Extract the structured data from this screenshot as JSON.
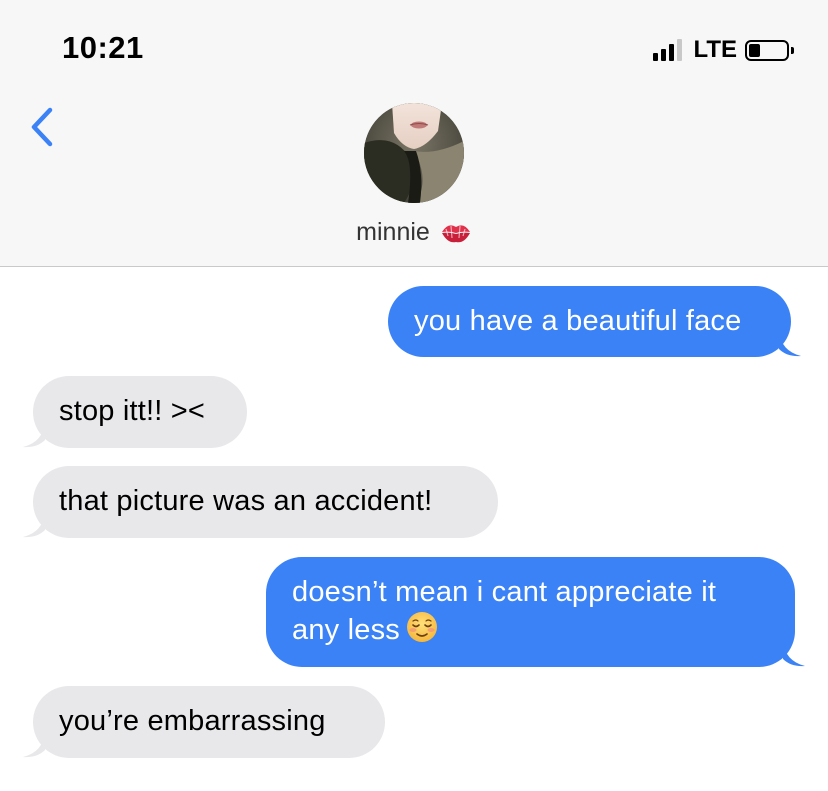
{
  "status_bar": {
    "time": "10:21",
    "network": "LTE",
    "battery_level": 0.25,
    "signal_bars": 3
  },
  "header": {
    "contact_name": "minnie",
    "contact_emoji": "kiss-mark-icon"
  },
  "messages": [
    {
      "direction": "sent",
      "text": "you have a beautiful face"
    },
    {
      "direction": "received",
      "text": "stop itt!! ><"
    },
    {
      "direction": "received",
      "text": "that picture was an accident!"
    },
    {
      "direction": "sent",
      "text_line1": "doesn’t mean i cant appreciate it",
      "text_line2": "any less",
      "emoji": "relieved-face-icon"
    },
    {
      "direction": "received",
      "text": "you’re embarrassing"
    }
  ],
  "colors": {
    "sent_bubble": "#3a82f6",
    "received_bubble": "#e8e8eb",
    "accent": "#3a82f6",
    "header_bg": "#f7f7f7"
  }
}
